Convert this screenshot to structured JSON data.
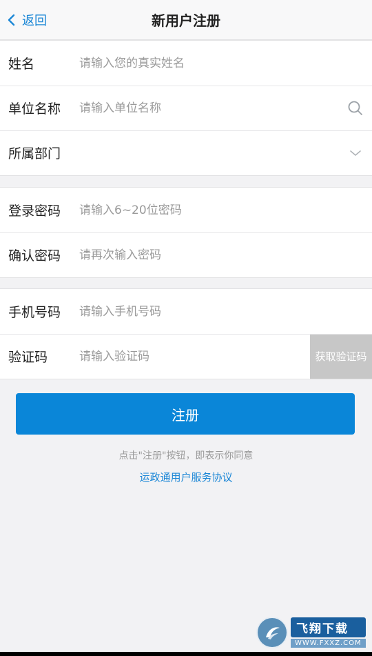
{
  "header": {
    "back_label": "返回",
    "title": "新用户注册"
  },
  "group1": {
    "name": {
      "label": "姓名",
      "placeholder": "请输入您的真实姓名",
      "value": ""
    },
    "unit": {
      "label": "单位名称",
      "placeholder": "请输入单位名称",
      "value": "",
      "icon": "search-icon"
    },
    "department": {
      "label": "所属部门",
      "value": "",
      "icon": "chevron-down-icon"
    }
  },
  "group2": {
    "password": {
      "label": "登录密码",
      "placeholder": "请输入6~20位密码",
      "value": ""
    },
    "confirm": {
      "label": "确认密码",
      "placeholder": "请再次输入密码",
      "value": ""
    }
  },
  "group3": {
    "phone": {
      "label": "手机号码",
      "placeholder": "请输入手机号码",
      "value": ""
    },
    "code": {
      "label": "验证码",
      "placeholder": "请输入验证码",
      "value": "",
      "button_label": "获取验证码"
    }
  },
  "register": {
    "button_label": "注册",
    "agreement_text": "点击\"注册\"按钮，即表示你同意",
    "agreement_link": "运政通用户服务协议"
  },
  "watermark": {
    "title": "飞翔下载",
    "subtitle": "WWW.FXXZ.COM"
  },
  "colors": {
    "accent": "#0a86d8",
    "link": "#1a86d6",
    "background": "#f2f2f4",
    "verify_button": "#c7c7c7"
  }
}
